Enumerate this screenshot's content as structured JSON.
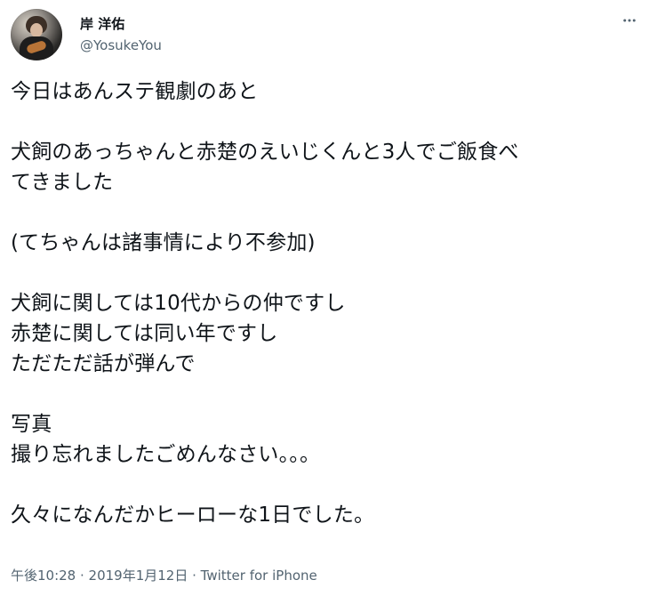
{
  "tweet": {
    "author": {
      "display_name": "岸 洋佑",
      "handle": "@YosukeYou"
    },
    "more_icon": "more-horizontal-icon",
    "text_lines": [
      "今日はあんステ観劇のあと",
      "",
      "犬飼のあっちゃんと赤楚のえいじくんと3人でご飯食べ",
      "てきました",
      "",
      "(てちゃんは諸事情により不参加)",
      "",
      "犬飼に関しては10代からの仲ですし",
      "赤楚に関しては同い年ですし",
      "ただただ話が弾んで",
      "",
      "写真",
      "撮り忘れましたごめんなさい。。。",
      "",
      "久々になんだかヒーローな1日でした。"
    ],
    "meta": {
      "time": "午後10:28",
      "separator1": " · ",
      "date": "2019年1月12日",
      "separator2": " · ",
      "source": "Twitter for iPhone"
    }
  },
  "colors": {
    "text": "#0f1419",
    "secondary": "#536471",
    "background": "#ffffff"
  }
}
